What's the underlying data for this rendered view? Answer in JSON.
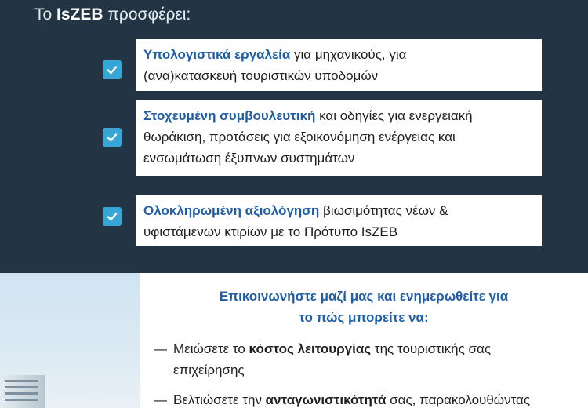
{
  "offers": {
    "intro_prefix": "Το",
    "brand": "IsZEB",
    "intro_suffix": "προσφέρει:",
    "items": [
      {
        "highlight": "Υπολογιστικά εργαλεία",
        "line1_rest": " για μηχανικούς,  για",
        "line2": "(ανα)κατασκευή τουριστικών υποδομών"
      },
      {
        "highlight": "Στοχευμένη συμβουλευτική",
        "line1_rest": " και οδηγίες για ενεργειακή",
        "line2": "θωράκιση, προτάσεις για εξοικονόμηση ενέργειας και",
        "line3": "ενσωμάτωση έξυπνων συστημάτων"
      },
      {
        "highlight": "Ολοκληρωμένη αξιολόγηση",
        "line1_rest": " βιωσιμότητας νέων &",
        "line2": "υφιστάμενων κτιρίων με το Πρότυπο IsZEB"
      }
    ]
  },
  "contact": {
    "title_line1": "Επικοινωνήστε μαζί μας και ενημερωθείτε για",
    "title_line2": "το πώς μπορείτε να:",
    "bullets": [
      {
        "dash": "—",
        "pre": "Μειώσετε το ",
        "bold": "κόστος λειτουργίας",
        "post": " της τουριστικής σας",
        "line2": "επιχείρησης"
      },
      {
        "dash": "—",
        "pre": "Βελτιώσετε την ",
        "bold": "ανταγωνιστικότητά",
        "post": " σας, παρακολουθώντας"
      }
    ]
  },
  "colors": {
    "top_bg": "#233544",
    "highlight": "#1f5ea6",
    "check": "#35a6d6"
  },
  "icons": {
    "check": "checkmark-icon"
  }
}
